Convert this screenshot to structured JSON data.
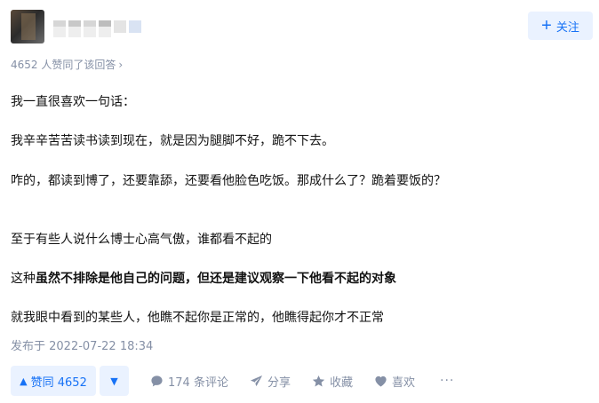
{
  "follow": {
    "label": "关注"
  },
  "upvoters": {
    "text": "4652 人赞同了该回答"
  },
  "content": {
    "p1": "我一直很喜欢一句话：",
    "p2": "我辛辛苦苦读书读到现在，就是因为腿脚不好，跪不下去。",
    "p3": "咋的，都读到博了，还要靠舔，还要看他脸色吃饭。那成什么了？跪着要饭的？",
    "p4": "至于有些人说什么博士心高气傲，谁都看不起的",
    "p5_prefix": "这种",
    "p5_bold": "虽然不排除是他自己的问题，但还是建议观察一下他看不起的对象",
    "p6": "就我眼中看到的某些人，他瞧不起你是正常的，他瞧得起你才不正常"
  },
  "published": "发布于 2022-07-22 18:34",
  "actions": {
    "upvote": "赞同 4652",
    "comments": "174 条评论",
    "share": "分享",
    "favorite": "收藏",
    "like": "喜欢",
    "more": "···"
  },
  "colors": {
    "accent": "#1772f6",
    "muted": "#8590a6",
    "button_bg": "#eaf2ff"
  }
}
